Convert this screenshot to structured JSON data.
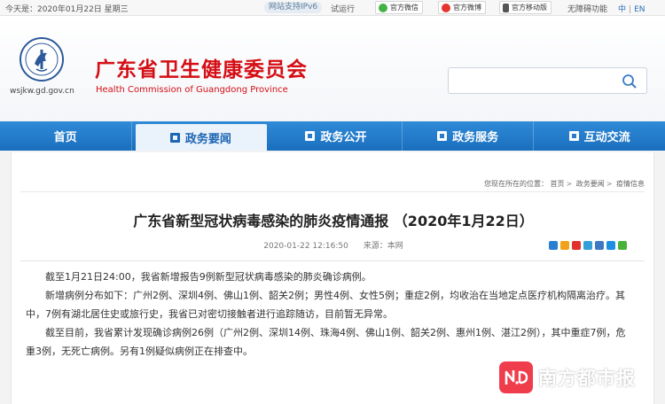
{
  "topbar": {
    "date": "今天是：2020年01月22日 星期三",
    "ipv6": "网站支持IPv6",
    "trial": "试运行",
    "wechat": "官方微信",
    "weibo": "官方微博",
    "mobile": "官方移动版",
    "accessibility": "无障碍功能",
    "lang_zh": "中",
    "lang_en": "EN"
  },
  "header": {
    "domain": "wsjkw.gd.gov.cn",
    "title": "广东省卫生健康委员会",
    "subtitle": "Health Commission of Guangdong Province",
    "search_placeholder": ""
  },
  "nav": [
    {
      "label": "首页",
      "icon": ""
    },
    {
      "label": "政务要闻",
      "icon": "news-icon"
    },
    {
      "label": "政务公开",
      "icon": "open-gov-icon"
    },
    {
      "label": "政务服务",
      "icon": "service-icon"
    },
    {
      "label": "互动交流",
      "icon": "chat-icon"
    }
  ],
  "breadcrumb": {
    "prefix": "您现在所在的位置：",
    "items": [
      "首页",
      "政务要闻",
      "疫情信息"
    ]
  },
  "article": {
    "title": "广东省新型冠状病毒感染的肺炎疫情通报 （2020年1月22日）",
    "date": "2020-01-22 12:16:50",
    "source": "来源：本网",
    "paragraphs": [
      "截至1月21日24:00，我省新增报告9例新型冠状病毒感染的肺炎确诊病例。",
      "新增病例分布如下：广州2例、深圳4例、佛山1例、韶关2例；男性4例、女性5例；重症2例，均收治在当地定点医疗机构隔离治疗。其中，7例有湖北居住史或旅行史，我省已对密切接触者进行追踪随访，目前暂无异常。",
      "截至目前，我省累计发现确诊病例26例（广州2例、深圳14例、珠海4例、佛山1例、韶关2例、惠州1例、湛江2例），其中重症7例，危重3例，无死亡病例。另有1例疑似病例正在排查中。"
    ]
  },
  "share_colors": [
    "#2b7fd1",
    "#f0a21a",
    "#e0312c",
    "#35a0d8",
    "#3d78c2",
    "#1d8fe0",
    "#48b13a"
  ],
  "watermark": {
    "text": "南方都市报",
    "logo_text": "N.D."
  },
  "colors": {
    "brand_red": "#d40e14",
    "nav_blue": "#1f76c6"
  }
}
